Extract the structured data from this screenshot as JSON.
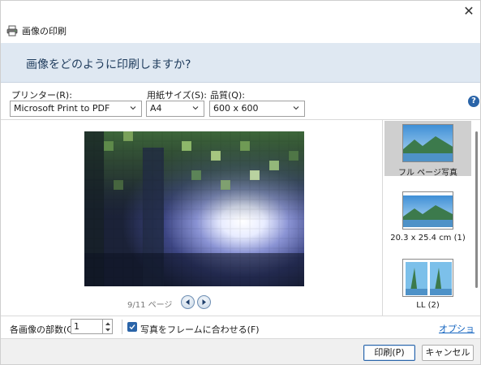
{
  "window": {
    "title": "画像の印刷",
    "close_symbol": "✕",
    "icons": {
      "app": "printer-icon",
      "close": "close-icon"
    }
  },
  "header": {
    "question": "画像をどのように印刷しますか?",
    "background_color": "#dfe8f2"
  },
  "controls": {
    "printer": {
      "label": "プリンター(R):",
      "value": "Microsoft Print to PDF"
    },
    "paper_size": {
      "label": "用紙サイズ(S):",
      "value": "A4"
    },
    "quality": {
      "label": "品質(Q):",
      "value": "600 x 600"
    },
    "help_symbol": "?"
  },
  "preview": {
    "page_indicator": "9/11 ページ",
    "icons": {
      "prev": "previous-page-icon",
      "next": "next-page-icon"
    },
    "image": "pixelated-forest-tunnel-photo"
  },
  "layouts": {
    "items": [
      {
        "label": "フル ページ写真",
        "selected": true,
        "thumbnail": "landscape-thumbnail"
      },
      {
        "label": "20.3 x 25.4 cm (1)",
        "selected": false,
        "thumbnail": "landscape-thumbnail"
      },
      {
        "label": "LL (2)",
        "selected": false,
        "thumbnail": "two-up-thumbnail"
      }
    ]
  },
  "bottom": {
    "copies_label": "各画像の部数(C):",
    "copies_value": "1",
    "fit_label": "写真をフレームに合わせる(F)",
    "fit_checked": true,
    "options_link": "オプション..."
  },
  "footer": {
    "print_button": "印刷(P)",
    "cancel_button": "キャンセル"
  },
  "colors": {
    "accent": "#2a64a8",
    "link": "#1565c0",
    "selected_layout": "#cfcfcf"
  }
}
